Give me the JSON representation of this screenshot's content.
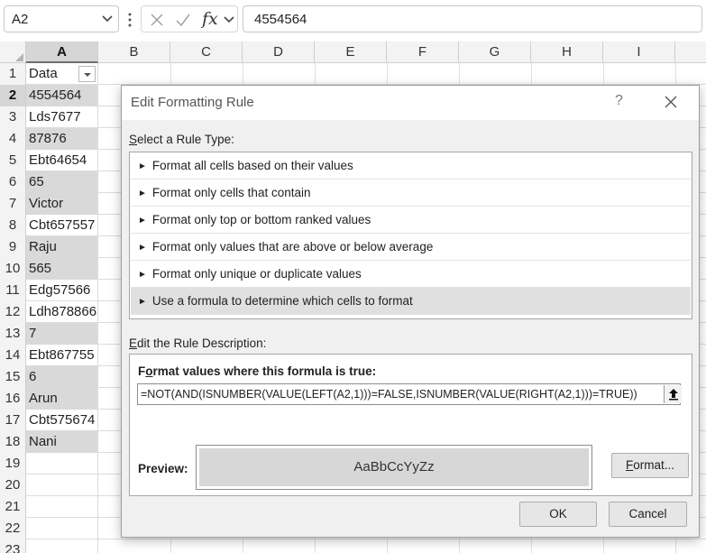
{
  "formula_bar": {
    "name_box": "A2",
    "fx_label": "fx",
    "formula": "4554564"
  },
  "grid": {
    "columns": [
      "A",
      "B",
      "C",
      "D",
      "E",
      "F",
      "G",
      "H",
      "I"
    ],
    "row_numbers": [
      "1",
      "2",
      "3",
      "4",
      "5",
      "6",
      "7",
      "8",
      "9",
      "10",
      "11",
      "12",
      "13",
      "14",
      "15",
      "16",
      "17",
      "18",
      "19",
      "20",
      "21",
      "22",
      "23"
    ],
    "column_a": [
      "Data",
      "4554564",
      "Lds7677",
      "87876",
      "Ebt64654",
      "65",
      "Victor",
      "Cbt657557",
      "Raju",
      "565",
      "Edg57566",
      "Ldh878866",
      "7",
      "Ebt867755",
      "6",
      "Arun",
      "Cbt575674",
      "Nani",
      "",
      "",
      "",
      "",
      ""
    ],
    "shaded_cell_color": "#d9d9d9"
  },
  "dialog": {
    "title": "Edit Formatting Rule",
    "help": "?",
    "select_rule_type_label": {
      "u": "S",
      "rest": "elect a Rule Type:"
    },
    "rule_types": [
      "Format all cells based on their values",
      "Format only cells that contain",
      "Format only top or bottom ranked values",
      "Format only values that are above or below average",
      "Format only unique or duplicate values",
      "Use a formula to determine which cells to format"
    ],
    "edit_description_label": {
      "u": "E",
      "rest": "dit the Rule Description:"
    },
    "formula_heading": {
      "pre": "F",
      "u": "o",
      "rest": "rmat values where this formula is true:"
    },
    "formula_value": "=NOT(AND(ISNUMBER(VALUE(LEFT(A2,1)))=FALSE,ISNUMBER(VALUE(RIGHT(A2,1)))=TRUE))",
    "preview_label": "Preview:",
    "preview_sample": "AaBbCcYyZz",
    "format_button": {
      "u": "F",
      "rest": "ormat..."
    },
    "ok_button": "OK",
    "cancel_button": "Cancel"
  }
}
